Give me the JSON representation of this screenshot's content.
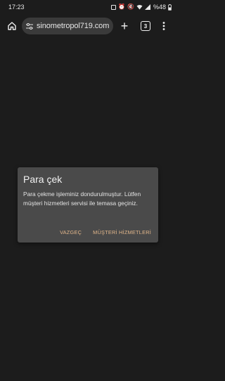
{
  "status_bar": {
    "time": "17:23",
    "battery": "%48"
  },
  "browser": {
    "url": "sinometropol719.com",
    "tab_count": "3",
    "icons": [
      "home-icon",
      "tune-icon",
      "plus-icon",
      "tabs-icon",
      "more-icon"
    ]
  },
  "dialog": {
    "title": "Para çek",
    "message": "Para çekme işleminiz dondurulmuştur. Lütfen müşteri hizmetleri servisi ile temasa geçiniz.",
    "cancel_label": "VAZGEÇ",
    "support_label": "MÜŞTERİ HİZMETLERİ",
    "accent_color": "#e0b58a"
  }
}
